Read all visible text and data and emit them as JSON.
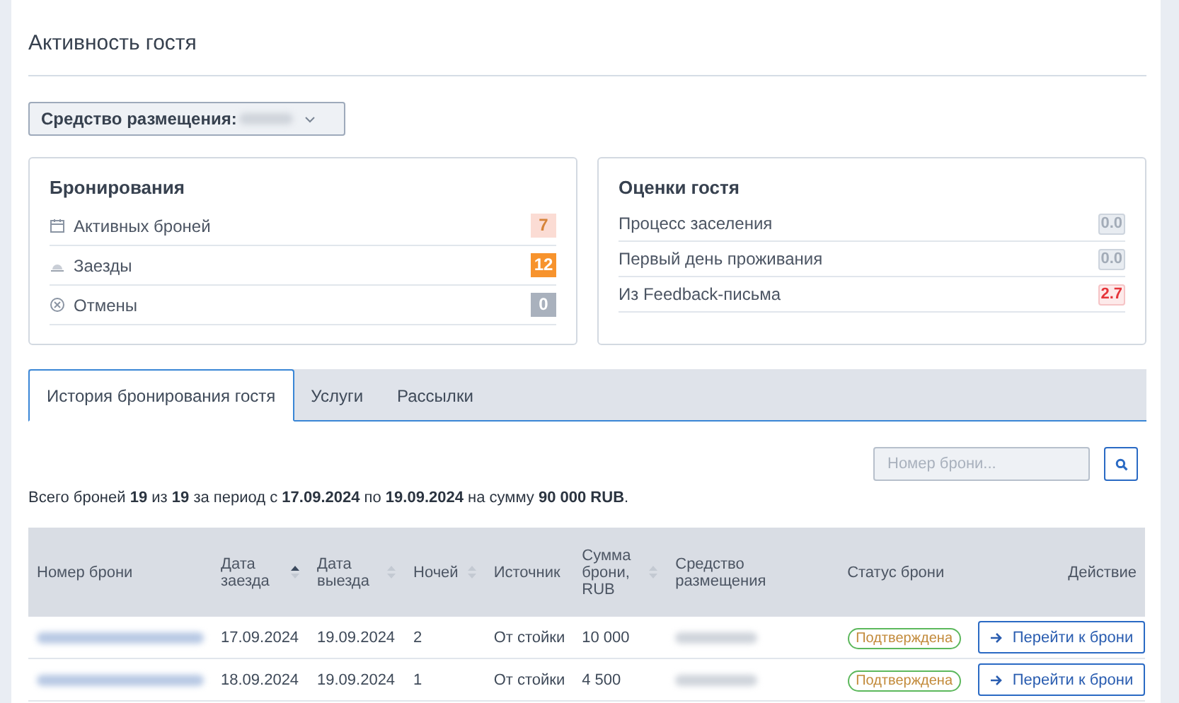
{
  "page_title": "Активность гостя",
  "property_filter": {
    "label": "Средство размещения:"
  },
  "bookings_card": {
    "title": "Бронирования",
    "items": [
      {
        "label": "Активных броней",
        "count": "7",
        "kind": "soft"
      },
      {
        "label": "Заезды",
        "count": "12",
        "kind": "strong"
      },
      {
        "label": "Отмены",
        "count": "0",
        "kind": "muted"
      }
    ]
  },
  "ratings_card": {
    "title": "Оценки гостя",
    "items": [
      {
        "label": "Процесс заселения",
        "score": "0.0",
        "kind": "neutral"
      },
      {
        "label": "Первый день проживания",
        "score": "0.0",
        "kind": "neutral"
      },
      {
        "label": "Из Feedback-письма",
        "score": "2.7",
        "kind": "danger"
      }
    ]
  },
  "tabs": [
    {
      "label": "История бронирования гостя",
      "selected": true
    },
    {
      "label": "Услуги",
      "selected": false
    },
    {
      "label": "Рассылки",
      "selected": false
    }
  ],
  "search": {
    "placeholder": "Номер брони..."
  },
  "summary": "Всего броней **19** из **19** за период с **17.09.2024** по **19.09.2024** на сумму **90 000 RUB**.",
  "table": {
    "columns": [
      {
        "label": "Номер брони"
      },
      {
        "label": "Дата заезда",
        "sortable": true,
        "sorted": true
      },
      {
        "label": "Дата выезда",
        "sortable": true,
        "sorted": false
      },
      {
        "label": "Ночей",
        "sortable": true,
        "sorted": false
      },
      {
        "label": "Источник"
      },
      {
        "label": "Сумма брони, RUB",
        "sortable": true,
        "sorted": false
      },
      {
        "label": "Средство размещения"
      },
      {
        "label": "Статус брони"
      },
      {
        "label": "Действие"
      }
    ],
    "rows": [
      {
        "check_in": "17.09.2024",
        "check_out": "19.09.2024",
        "nights": "2",
        "source": "От стойки",
        "amount": "10 000",
        "status": "Подтверждена",
        "confirmed": true,
        "action": "Перейти к брони"
      },
      {
        "check_in": "18.09.2024",
        "check_out": "19.09.2024",
        "nights": "1",
        "source": "От стойки",
        "amount": "4 500",
        "status": "Подтверждена",
        "confirmed": true,
        "action": "Перейти к брони"
      }
    ]
  }
}
